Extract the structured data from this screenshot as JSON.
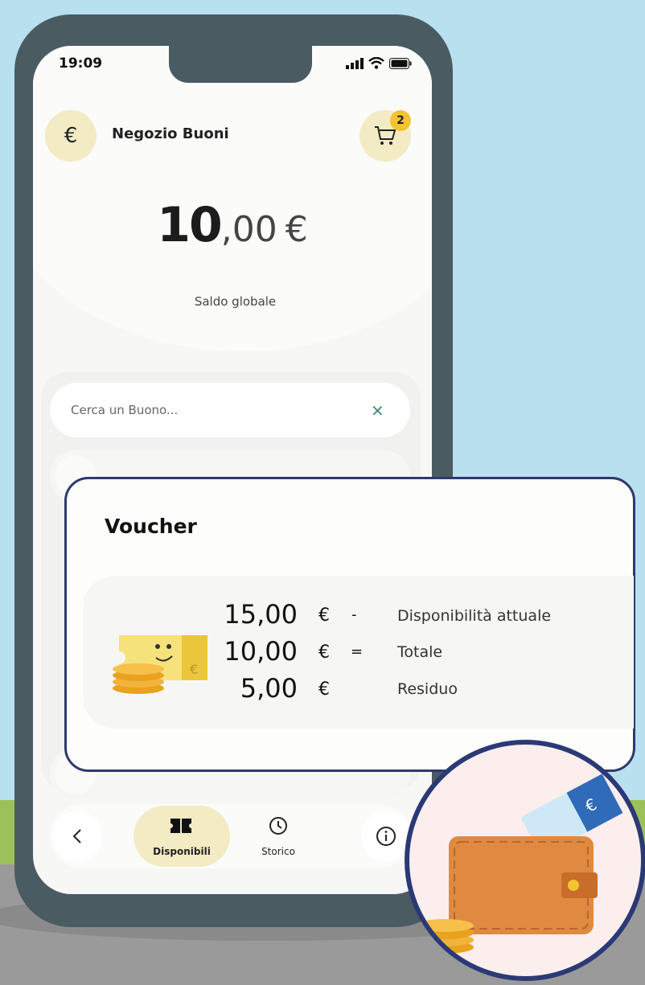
{
  "status": {
    "time": "19:09"
  },
  "header": {
    "title": "Negozio Buoni",
    "currency_symbol": "€",
    "cart_count": "2"
  },
  "balance": {
    "integer": "10",
    "decimal": ",00",
    "currency": "€",
    "label": "Saldo globale"
  },
  "search": {
    "placeholder": "Cerca un Buono..."
  },
  "voucher": {
    "title": "Voucher",
    "rows": [
      {
        "amount": "15,00",
        "currency": "€",
        "operator": "-",
        "label": "Disponibilità attuale"
      },
      {
        "amount": "10,00",
        "currency": "€",
        "operator": "=",
        "label": "Totale"
      },
      {
        "amount": "5,00",
        "currency": "€",
        "operator": "",
        "label": "Residuo"
      }
    ]
  },
  "bottom_nav": {
    "back_icon": "chevron-left-icon",
    "tabs": [
      {
        "label": "Disponibili",
        "icon": "ticket-icon",
        "active": true
      },
      {
        "label": "Storico",
        "icon": "history-icon",
        "active": false
      }
    ],
    "info_icon": "info-icon"
  },
  "colors": {
    "accent": "#f3ebc4",
    "badge": "#f4c430",
    "phone": "#4a5b62",
    "card_border": "#2c3a6e"
  }
}
